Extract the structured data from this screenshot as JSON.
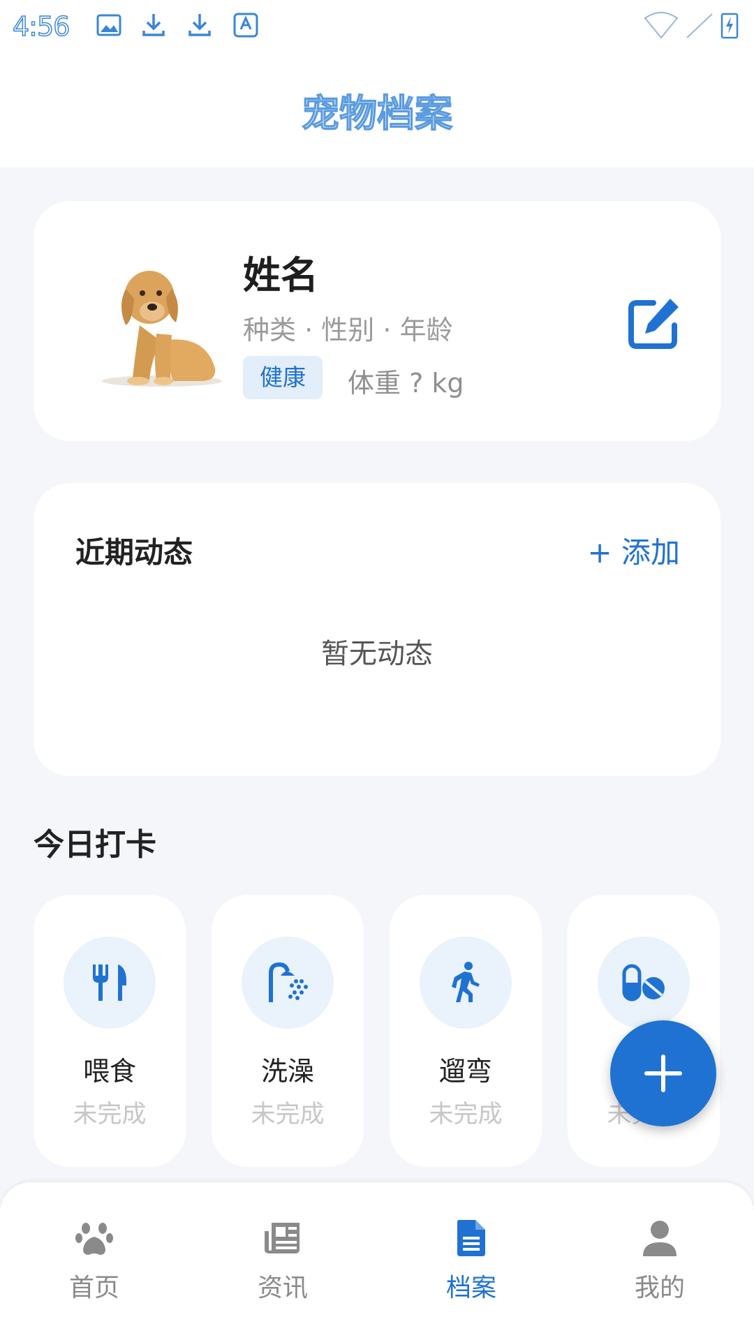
{
  "status_bar": {
    "time": "4:56",
    "icons": [
      "image-icon",
      "download-icon",
      "download-icon",
      "font-icon",
      "wifi-icon",
      "signal-icon",
      "battery-charging-icon"
    ]
  },
  "header": {
    "title": "宠物档案"
  },
  "profile": {
    "name": "姓名",
    "subtitle": "种类 · 性别 · 年龄",
    "health_badge": "健康",
    "weight": "体重 ? kg",
    "edit_icon": "edit-icon"
  },
  "activity": {
    "title": "近期动态",
    "add_label": "+ 添加",
    "empty_text": "暂无动态"
  },
  "checkin": {
    "title": "今日打卡",
    "items": [
      {
        "label": "喂食",
        "status": "未完成",
        "icon": "fork-knife-icon"
      },
      {
        "label": "洗澡",
        "status": "未完成",
        "icon": "shower-icon"
      },
      {
        "label": "遛弯",
        "status": "未完成",
        "icon": "walking-icon"
      },
      {
        "label": "",
        "status": "未完成",
        "icon": "pills-icon"
      }
    ]
  },
  "fab": {
    "icon": "plus-icon"
  },
  "bottom_nav": {
    "items": [
      {
        "label": "首页",
        "icon": "paw-icon",
        "active": false
      },
      {
        "label": "资讯",
        "icon": "newspaper-icon",
        "active": false
      },
      {
        "label": "档案",
        "icon": "file-icon",
        "active": true
      },
      {
        "label": "我的",
        "icon": "user-icon",
        "active": false
      }
    ]
  },
  "colors": {
    "accent": "#1f72d1",
    "background": "#f4f6f9",
    "badge_bg": "#e3eefb",
    "muted": "#9a9a9a"
  }
}
